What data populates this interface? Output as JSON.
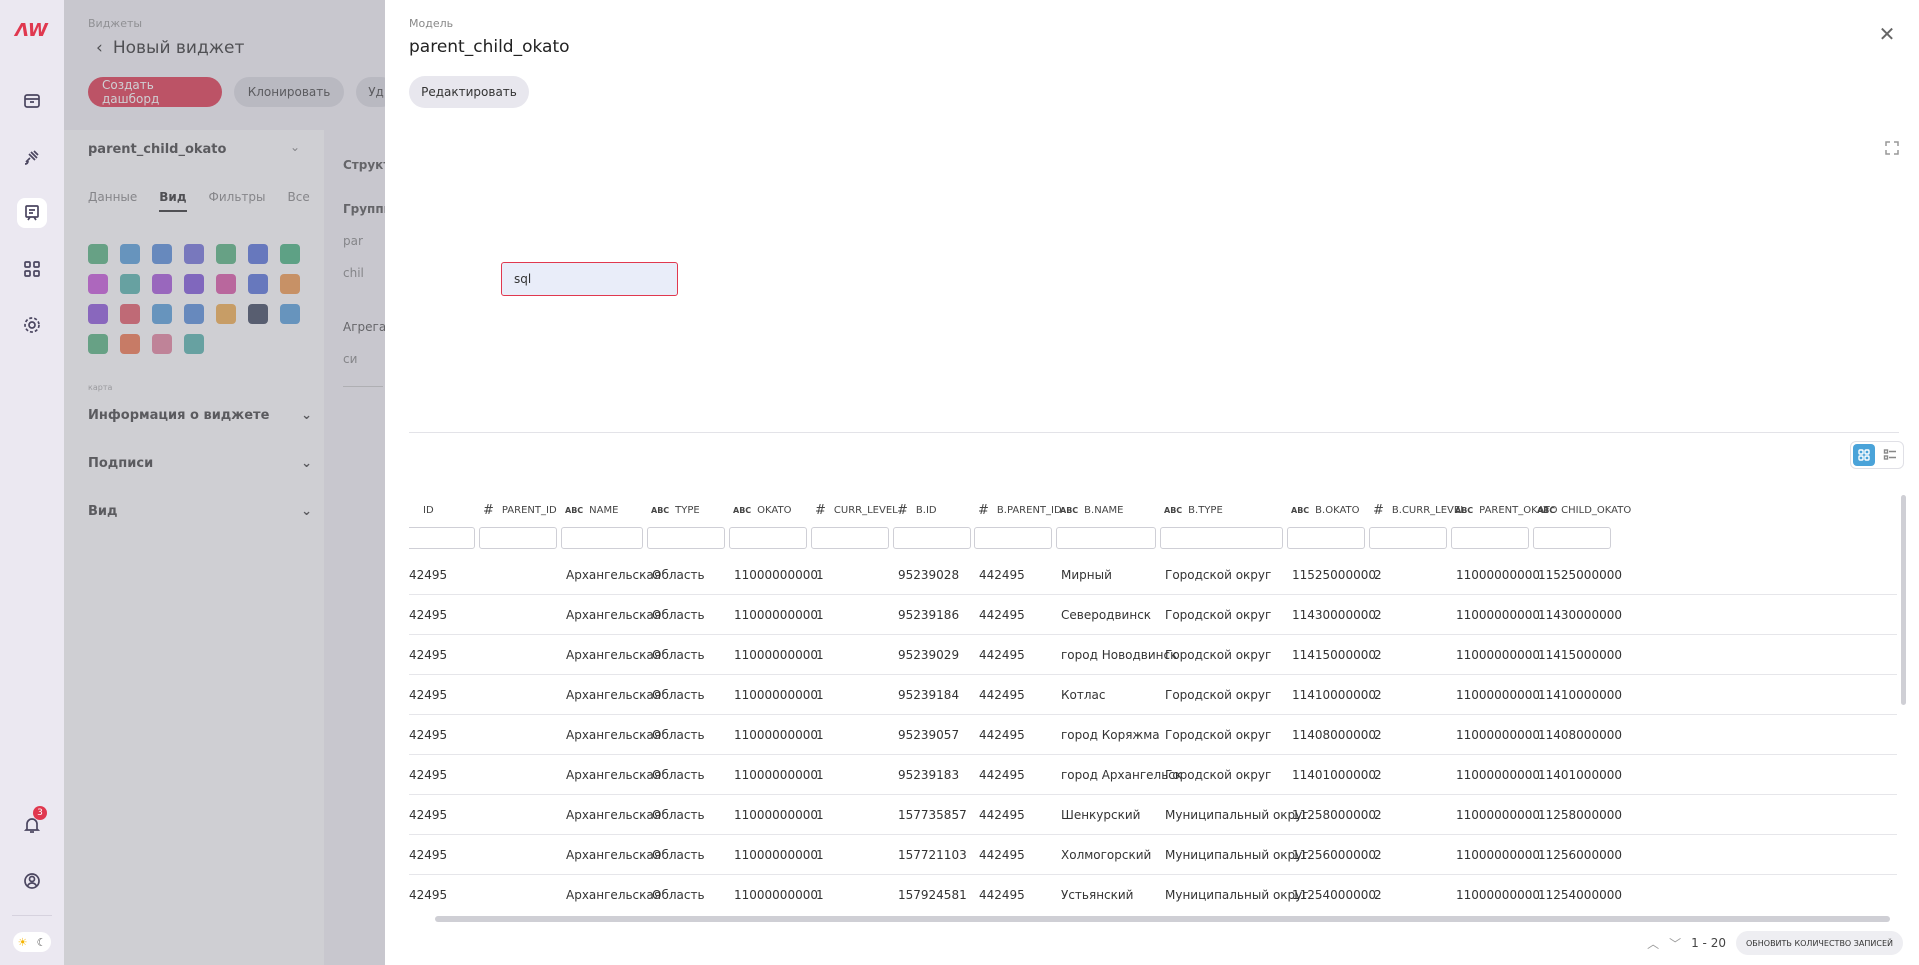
{
  "background": {
    "breadcrumb": "Виджеты",
    "title": "Новый виджет",
    "create_dashboard": "Создать дашборд",
    "clone": "Клонировать",
    "delete_short": "Уд",
    "model_name": "parent_child_okato",
    "tabs": [
      "Данные",
      "Вид",
      "Фильтры",
      "Все"
    ],
    "map_label": "карта",
    "sections": [
      "Информация о виджете",
      "Подписи",
      "Вид"
    ],
    "right_labels": [
      "Структ",
      "Группы",
      "par",
      "chil",
      "Агрегат",
      "си"
    ]
  },
  "rail": {
    "notification_count": "3"
  },
  "modal": {
    "label": "Модель",
    "title": "parent_child_okato",
    "edit_button": "Редактировать",
    "sql_node": "sql"
  },
  "table": {
    "columns": [
      {
        "name": "ID",
        "type": ""
      },
      {
        "name": "PARENT_ID",
        "type": "#"
      },
      {
        "name": "NAME",
        "type": "ABC"
      },
      {
        "name": "TYPE",
        "type": "ABC"
      },
      {
        "name": "OKATO",
        "type": "ABC"
      },
      {
        "name": "CURR_LEVEL",
        "type": "#"
      },
      {
        "name": "B.ID",
        "type": "#"
      },
      {
        "name": "B.PARENT_ID",
        "type": "#"
      },
      {
        "name": "B.NAME",
        "type": "ABC"
      },
      {
        "name": "B.TYPE",
        "type": "ABC"
      },
      {
        "name": "B.OKATO",
        "type": "ABC"
      },
      {
        "name": "B.CURR_LEVEL",
        "type": "#"
      },
      {
        "name": "PARENT_OKATO",
        "type": "ABC"
      },
      {
        "name": "CHILD_OKATO",
        "type": "ABC"
      }
    ],
    "rows": [
      [
        "42495",
        "",
        "Архангельская",
        "Область",
        "11000000000",
        "1",
        "95239028",
        "442495",
        "Мирный",
        "Городской округ",
        "11525000000",
        "2",
        "11000000000",
        "11525000000"
      ],
      [
        "42495",
        "",
        "Архангельская",
        "Область",
        "11000000000",
        "1",
        "95239186",
        "442495",
        "Северодвинск",
        "Городской округ",
        "11430000000",
        "2",
        "11000000000",
        "11430000000"
      ],
      [
        "42495",
        "",
        "Архангельская",
        "Область",
        "11000000000",
        "1",
        "95239029",
        "442495",
        "город Новодвинск",
        "Городской округ",
        "11415000000",
        "2",
        "11000000000",
        "11415000000"
      ],
      [
        "42495",
        "",
        "Архангельская",
        "Область",
        "11000000000",
        "1",
        "95239184",
        "442495",
        "Котлас",
        "Городской округ",
        "11410000000",
        "2",
        "11000000000",
        "11410000000"
      ],
      [
        "42495",
        "",
        "Архангельская",
        "Область",
        "11000000000",
        "1",
        "95239057",
        "442495",
        "город Коряжма",
        "Городской округ",
        "11408000000",
        "2",
        "11000000000",
        "11408000000"
      ],
      [
        "42495",
        "",
        "Архангельская",
        "Область",
        "11000000000",
        "1",
        "95239183",
        "442495",
        "город Архангельск",
        "Городской округ",
        "11401000000",
        "2",
        "11000000000",
        "11401000000"
      ],
      [
        "42495",
        "",
        "Архангельская",
        "Область",
        "11000000000",
        "1",
        "157735857",
        "442495",
        "Шенкурский",
        "Муниципальный округ",
        "11258000000",
        "2",
        "11000000000",
        "11258000000"
      ],
      [
        "42495",
        "",
        "Архангельская",
        "Область",
        "11000000000",
        "1",
        "157721103",
        "442495",
        "Холмогорский",
        "Муниципальный округ",
        "11256000000",
        "2",
        "11000000000",
        "11256000000"
      ],
      [
        "42495",
        "",
        "Архангельская",
        "Область",
        "11000000000",
        "1",
        "157924581",
        "442495",
        "Устьянский",
        "Муниципальный округ",
        "11254000000",
        "2",
        "11000000000",
        "11254000000"
      ]
    ]
  },
  "pager": {
    "range": "1 - 20",
    "refresh_button": "ОБНОВИТЬ КОЛИЧЕСТВО ЗАПИСЕЙ"
  }
}
